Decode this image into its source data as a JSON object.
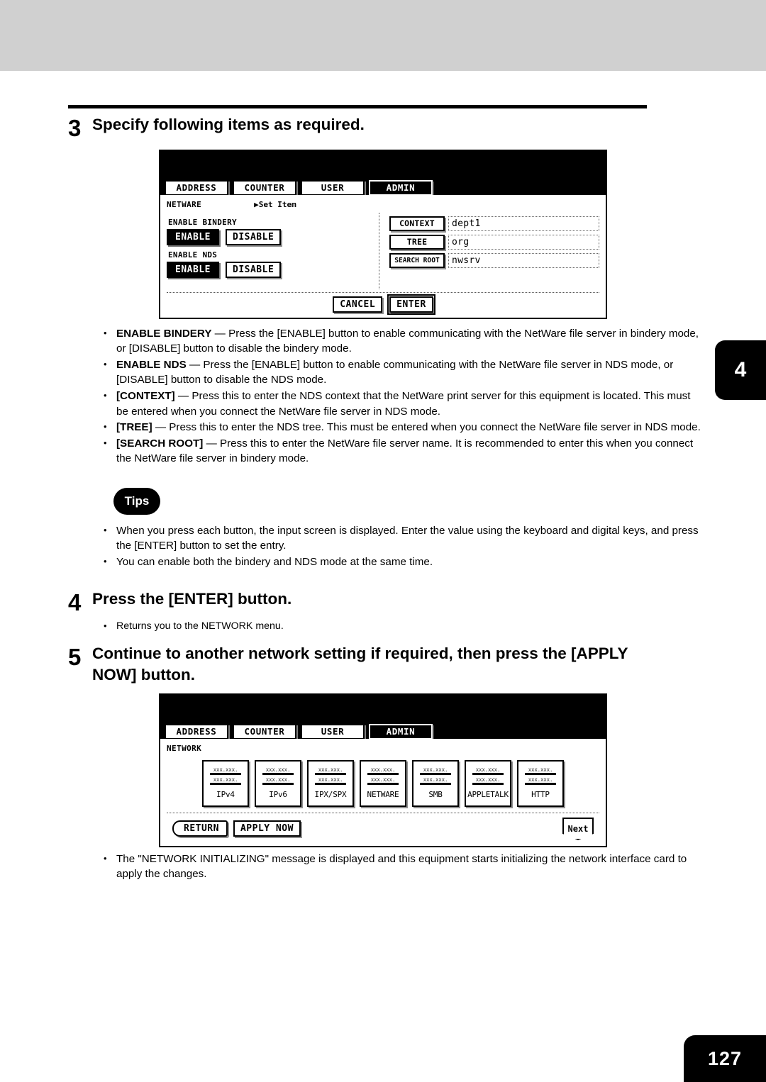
{
  "page": {
    "number": "127",
    "chapter_tab": "4"
  },
  "steps": [
    {
      "num": "3",
      "title": "Specify following items as required."
    },
    {
      "num": "4",
      "title": "Press the [ENTER] button."
    },
    {
      "num": "5",
      "title": "Continue to another network setting if required, then press the [APPLY NOW] button."
    }
  ],
  "step3_bullets": [
    {
      "term": "ENABLE BINDERY",
      "rest": " — Press the [ENABLE] button to enable communicating with the NetWare file server in bindery mode, or [DISABLE] button to disable the bindery mode."
    },
    {
      "term": "ENABLE NDS",
      "rest": " — Press the [ENABLE] button to enable communicating with the NetWare file server in NDS mode, or [DISABLE] button to disable the NDS mode."
    },
    {
      "term": "[CONTEXT]",
      "rest": " — Press this to enter the NDS context that the NetWare print server for this equipment is located. This must be entered when you connect the NetWare file server in NDS mode."
    },
    {
      "term": "[TREE]",
      "rest": " — Press this to enter the NDS tree.  This must be entered when you connect the NetWare file server in NDS mode."
    },
    {
      "term": "[SEARCH ROOT]",
      "rest": " — Press this to enter the NetWare file server name.  It is recommended to enter this when you connect the NetWare file server in bindery mode."
    }
  ],
  "tips": {
    "badge": "Tips",
    "items": [
      "When you press each button, the input screen is displayed.  Enter the value using the keyboard and digital keys, and press the [ENTER] button to set the entry.",
      "You can enable both the bindery and NDS mode at the same time."
    ]
  },
  "step4_bullets": [
    "Returns you to the NETWORK menu."
  ],
  "step5_bullets": [
    "The \"NETWORK INITIALIZING\" message is displayed and this equipment starts initializing the network interface card to apply the changes."
  ],
  "panel1": {
    "tabs": [
      {
        "label": "ADDRESS",
        "selected": false
      },
      {
        "label": "COUNTER",
        "selected": false
      },
      {
        "label": "USER",
        "selected": false
      },
      {
        "label": "ADMIN",
        "selected": true
      }
    ],
    "title": "NETWARE",
    "set_item": "▶Set Item",
    "groups": [
      {
        "label": "ENABLE BINDERY",
        "buttons": [
          {
            "label": "ENABLE",
            "selected": true
          },
          {
            "label": "DISABLE",
            "selected": false
          }
        ]
      },
      {
        "label": "ENABLE NDS",
        "buttons": [
          {
            "label": "ENABLE",
            "selected": true
          },
          {
            "label": "DISABLE",
            "selected": false
          }
        ]
      }
    ],
    "fields": [
      {
        "label": "CONTEXT",
        "value": "dept1"
      },
      {
        "label": "TREE",
        "value": "org"
      },
      {
        "label": "SEARCH ROOT",
        "value": "nwsrv"
      }
    ],
    "footer": [
      {
        "label": "CANCEL",
        "emphasis": false
      },
      {
        "label": "ENTER",
        "emphasis": true
      }
    ]
  },
  "panel2": {
    "tabs": [
      {
        "label": "ADDRESS",
        "selected": false
      },
      {
        "label": "COUNTER",
        "selected": false
      },
      {
        "label": "USER",
        "selected": false
      },
      {
        "label": "ADMIN",
        "selected": true
      }
    ],
    "title": "NETWORK",
    "icon_line1": "xxx.xxx.",
    "icon_line2": "xxx.xxx.",
    "items": [
      {
        "name": "IPv4"
      },
      {
        "name": "IPv6"
      },
      {
        "name": "IPX/SPX"
      },
      {
        "name": "NETWARE"
      },
      {
        "name": "SMB"
      },
      {
        "name": "APPLETALK"
      },
      {
        "name": "HTTP"
      }
    ],
    "footer": {
      "return_label": "RETURN",
      "apply_label": "APPLY NOW",
      "next_label": "Next"
    }
  }
}
